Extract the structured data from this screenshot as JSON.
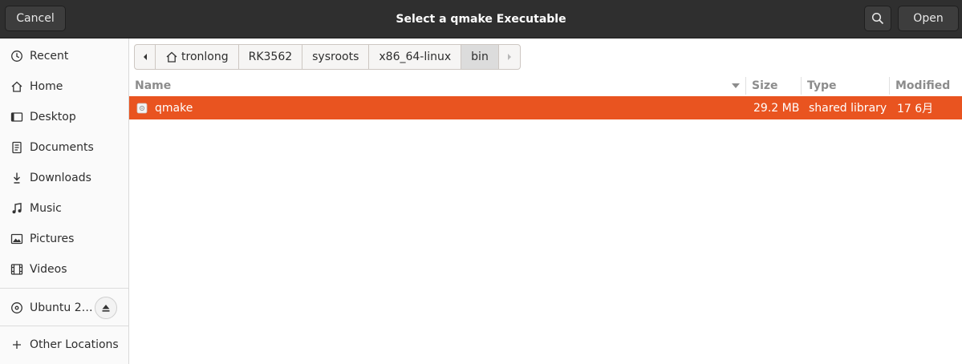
{
  "header": {
    "cancel_label": "Cancel",
    "title": "Select a qmake Executable",
    "open_label": "Open"
  },
  "sidebar": {
    "items": [
      {
        "label": "Recent",
        "icon": "clock-icon"
      },
      {
        "label": "Home",
        "icon": "home-icon"
      },
      {
        "label": "Desktop",
        "icon": "desktop-icon"
      },
      {
        "label": "Documents",
        "icon": "document-icon"
      },
      {
        "label": "Downloads",
        "icon": "download-icon"
      },
      {
        "label": "Music",
        "icon": "music-note-icon"
      },
      {
        "label": "Pictures",
        "icon": "picture-icon"
      },
      {
        "label": "Videos",
        "icon": "film-icon"
      }
    ],
    "drive": {
      "label": "Ubuntu 2…",
      "icon": "disc-icon",
      "eject_icon": "eject-icon"
    },
    "other": {
      "label": "Other Locations",
      "icon": "plus-icon"
    }
  },
  "pathbar": {
    "crumbs": [
      "tronlong",
      "RK3562",
      "sysroots",
      "x86_64-linux",
      "bin"
    ],
    "active": "bin"
  },
  "columns": {
    "name": "Name",
    "size": "Size",
    "type": "Type",
    "modified": "Modified"
  },
  "files": [
    {
      "name": "qmake",
      "size": "29.2 MB",
      "type": "shared library",
      "modified": "17 6月",
      "selected": true
    }
  ],
  "colors": {
    "accent": "#e95420",
    "headerbar": "#2f2f2f"
  }
}
